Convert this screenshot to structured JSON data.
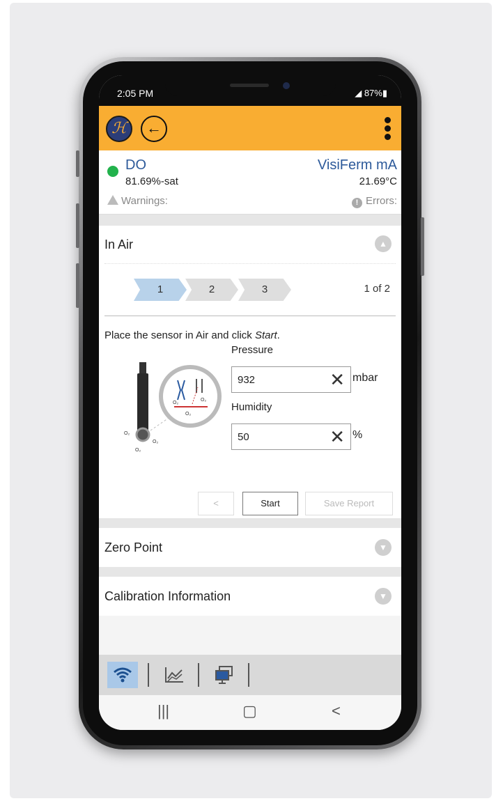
{
  "status": {
    "time": "2:05 PM",
    "battery": "◢ 87%▮"
  },
  "app": {
    "logo_text": "ℋ",
    "back_icon": "←",
    "menu_icon": "kebab"
  },
  "reading": {
    "param": "DO",
    "value": "81.69%-sat",
    "sensor": "VisiFerm mA",
    "temperature": "21.69°C",
    "warnings_label": "Warnings:",
    "errors_label": "Errors:",
    "status_color": "#22b24c"
  },
  "in_air": {
    "title": "In Air",
    "steps": [
      "1",
      "2",
      "3"
    ],
    "active_step": "1",
    "page_of": "1 of 2",
    "instruction_prefix": "Place the sensor in Air and click ",
    "instruction_emph": "Start",
    "instruction_suffix": ".",
    "pressure_label": "Pressure",
    "pressure_value": "932",
    "pressure_unit": "mbar",
    "humidity_label": "Humidity",
    "humidity_value": "50",
    "humidity_unit": "%",
    "prev_label": "<",
    "start_label": "Start",
    "save_label": "Save Report",
    "diagram_labels": {
      "o2": "O₂"
    }
  },
  "zero_point": {
    "title": "Zero Point"
  },
  "calibration_info": {
    "title": "Calibration Information"
  },
  "tabs": [
    {
      "icon": "wifi-icon",
      "glyph": "📶"
    },
    {
      "icon": "chart-icon",
      "glyph": "📈"
    },
    {
      "icon": "devices-icon",
      "glyph": "🖥"
    }
  ],
  "nav": {
    "recent": "|||",
    "home": "▢",
    "back": "<"
  },
  "colors": {
    "accent": "#f9ad32",
    "link": "#2d5a9a",
    "active_step": "#b8d2ea",
    "selected_tab": "#a9c8e8"
  }
}
